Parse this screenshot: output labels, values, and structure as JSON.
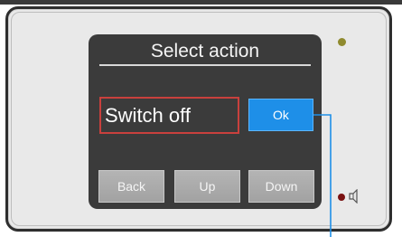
{
  "screen": {
    "title": "Select action",
    "action_value": "Switch off",
    "ok_label": "Ok"
  },
  "nav": {
    "back_label": "Back",
    "up_label": "Up",
    "down_label": "Down"
  },
  "icons": {
    "status_led": "status-led-icon",
    "record_dot": "record-dot-icon",
    "speaker": "speaker-icon"
  },
  "colors": {
    "ok_button": "#1e8fe8",
    "selection_border": "#c9403d",
    "connector_line": "#1e8fe8"
  }
}
